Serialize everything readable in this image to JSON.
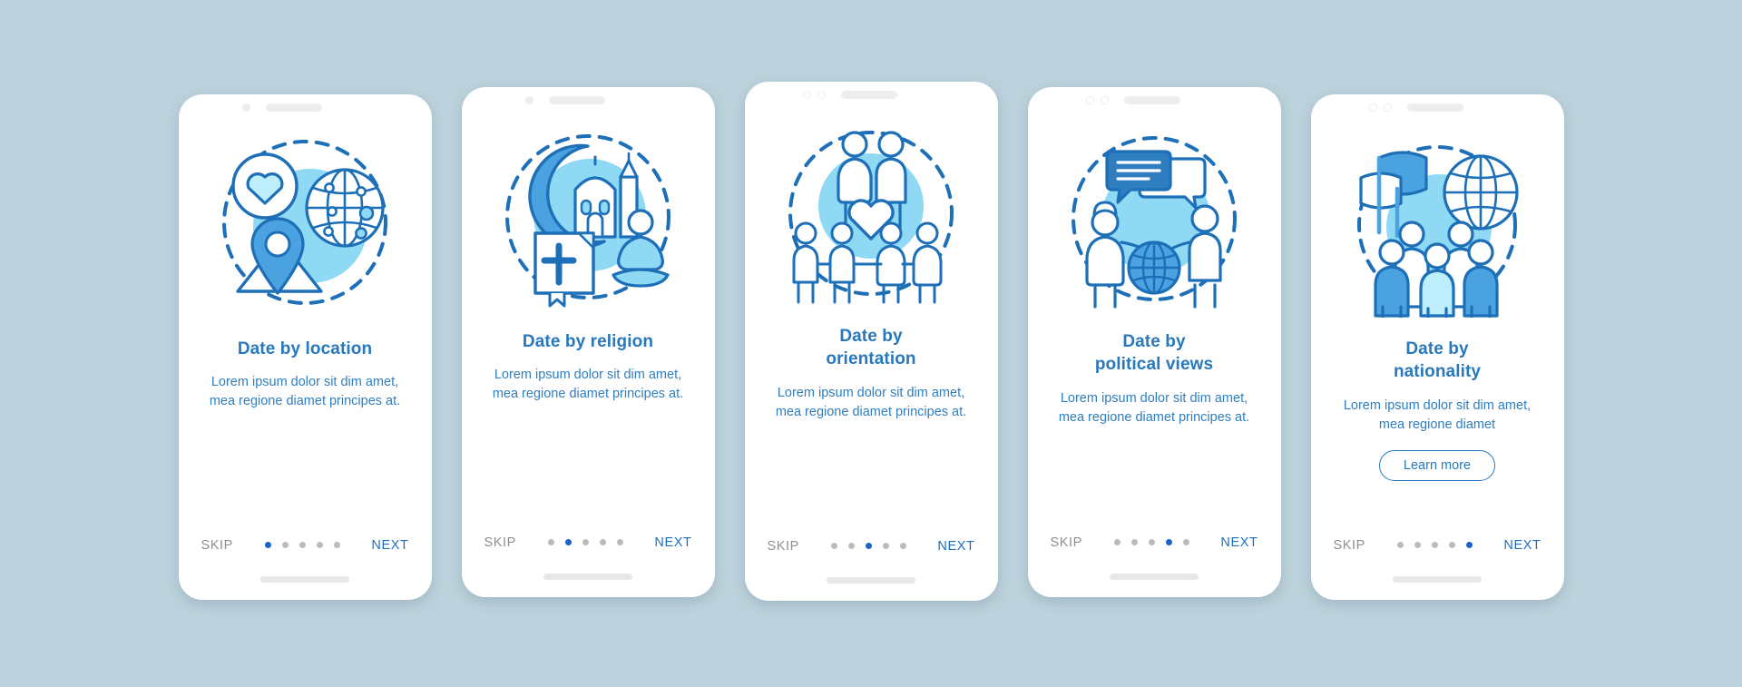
{
  "theme": {
    "background": "#bcd2dc",
    "card_background": "#ffffff",
    "title_color": "#2878bd",
    "body_color": "#2f7ec0",
    "accent_blue": "#1964c8",
    "skip_color": "#8a8f94",
    "next_color": "#1f6fc0",
    "icon_dark_blue": "#1d6fb8",
    "icon_mid_blue": "#4aa3e0",
    "icon_light_blue": "#8fd9f5",
    "icon_pale_blue": "#bdeefb"
  },
  "common": {
    "skip_label": "SKIP",
    "next_label": "NEXT",
    "body_text": "Lorem ipsum dolor sit dim amet, mea regione diamet principes at.",
    "body_text_short": "Lorem ipsum dolor sit dim amet, mea regione diamet",
    "total_steps": 5
  },
  "screens": [
    {
      "index": 1,
      "title": "Date by location",
      "title_lines": [
        "Date by location"
      ],
      "body": "Lorem ipsum dolor sit dim amet, mea regione diamet principes at.",
      "skip_label": "SKIP",
      "next_label": "NEXT",
      "active_dot": 1,
      "icon_name": "location-heart-globe-icon",
      "statusbar": {
        "dots": 1,
        "style": "filled"
      },
      "cta": null
    },
    {
      "index": 2,
      "title": "Date by religion",
      "title_lines": [
        "Date by religion"
      ],
      "body": "Lorem ipsum dolor sit dim amet, mea regione diamet principes at.",
      "skip_label": "SKIP",
      "next_label": "NEXT",
      "active_dot": 2,
      "icon_name": "religion-mosque-bible-meditation-icon",
      "statusbar": {
        "dots": 1,
        "style": "filled"
      },
      "cta": null
    },
    {
      "index": 3,
      "title": "Date by orientation",
      "title_lines": [
        "Date by",
        "orientation"
      ],
      "body": "Lorem ipsum dolor sit dim amet, mea regione diamet principes at.",
      "skip_label": "SKIP",
      "next_label": "NEXT",
      "active_dot": 3,
      "icon_name": "orientation-couples-heart-icon",
      "statusbar": {
        "dots": 2,
        "style": "ring"
      },
      "cta": null
    },
    {
      "index": 4,
      "title": "Date by political views",
      "title_lines": [
        "Date by",
        "political views"
      ],
      "body": "Lorem ipsum dolor sit dim amet, mea regione diamet principes at.",
      "skip_label": "SKIP",
      "next_label": "NEXT",
      "active_dot": 4,
      "icon_name": "political-views-debate-globe-icon",
      "statusbar": {
        "dots": 2,
        "style": "ring"
      },
      "cta": null
    },
    {
      "index": 5,
      "title": "Date by nationality",
      "title_lines": [
        "Date by",
        "nationality"
      ],
      "body": "Lorem ipsum dolor sit dim amet, mea regione diamet",
      "skip_label": "SKIP",
      "next_label": "NEXT",
      "active_dot": 5,
      "icon_name": "nationality-flag-globe-people-icon",
      "statusbar": {
        "dots": 2,
        "style": "ring"
      },
      "cta": {
        "label": "Learn more",
        "name": "learn-more-button"
      }
    }
  ]
}
